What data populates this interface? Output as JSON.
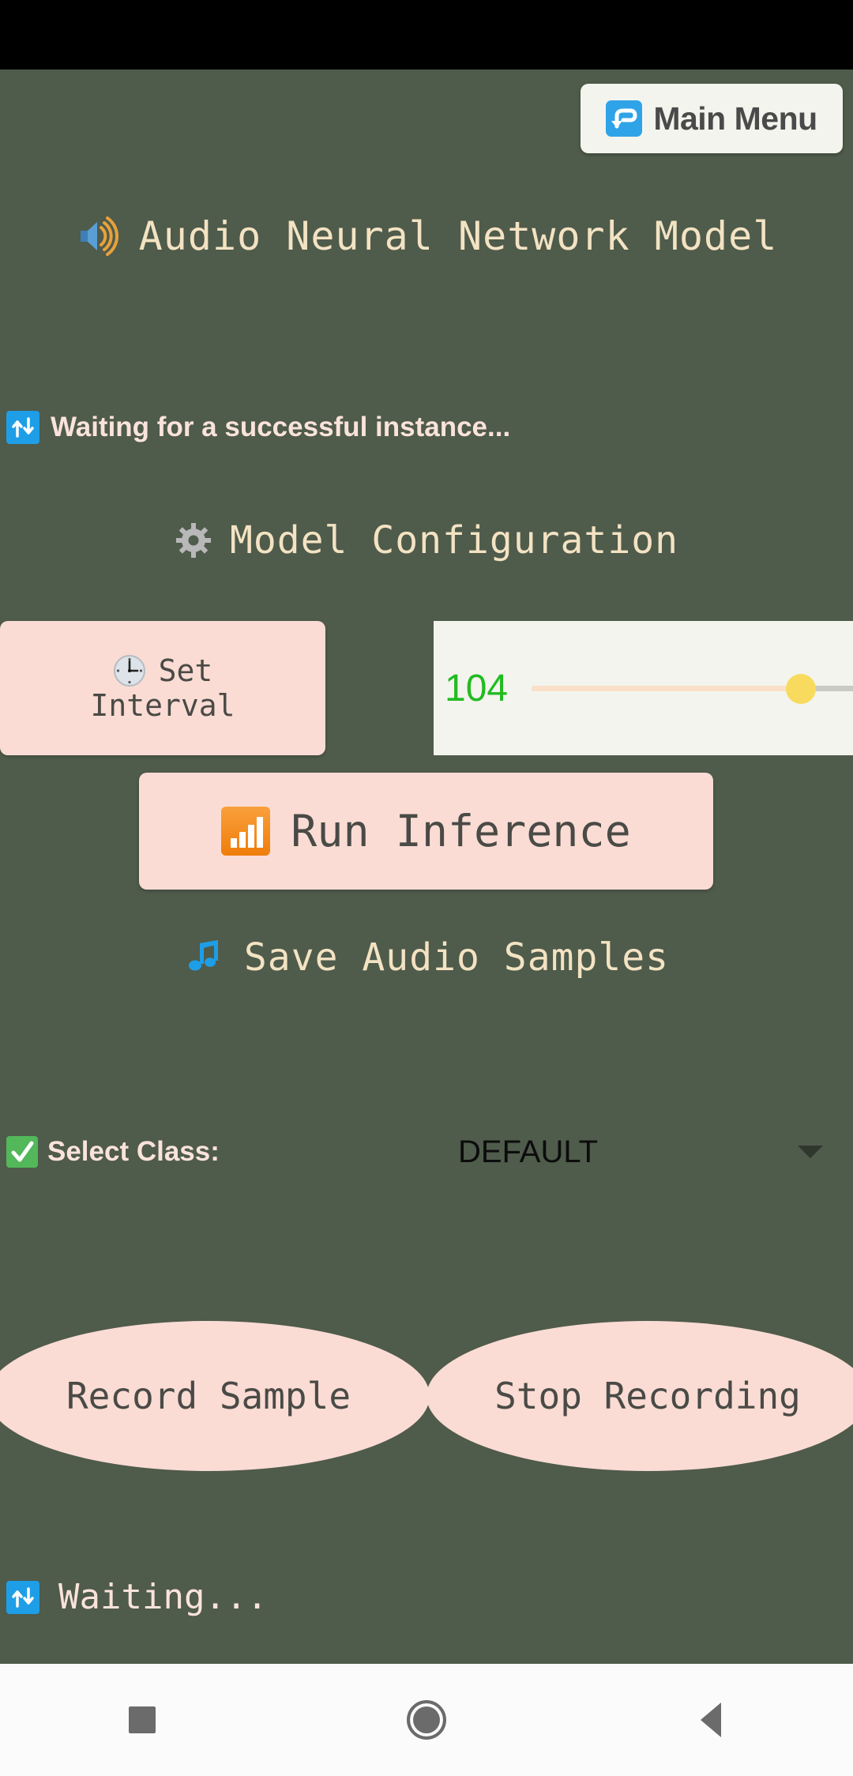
{
  "app": {
    "title": "Audio Neural Network Model",
    "title_icon": "loud-speaker-icon"
  },
  "header": {
    "main_menu_label": "Main Menu",
    "main_menu_icon": "return-arrow-icon"
  },
  "status": {
    "top_message": "Waiting for a successful instance...",
    "top_icon": "up-down-arrow-icon",
    "bottom_message": "Waiting...",
    "bottom_icon": "up-down-arrow-icon"
  },
  "config": {
    "heading": "Model Configuration",
    "heading_icon": "gear-icon",
    "set_interval_line1": "Set",
    "set_interval_line2": "Interval",
    "set_interval_icon": "clock-icon",
    "slider_value": "104",
    "slider_percent": 83,
    "run_inference_label": "Run Inference",
    "run_inference_icon": "bar-chart-icon"
  },
  "save_audio": {
    "heading": "Save Audio Samples",
    "heading_icon": "musical-notes-icon",
    "select_class_label": "Select Class:",
    "select_class_icon": "check-mark-icon",
    "selected_class": "DEFAULT",
    "record_label": "Record Sample",
    "stop_label": "Stop Recording"
  },
  "navbar": {
    "recents": "recents-square",
    "home": "home-circle",
    "back": "back-triangle"
  },
  "colors": {
    "background": "#4f5b4b",
    "panel": "#fadcd4",
    "heading_text": "#f3e3c3",
    "status_text": "#fae3da",
    "slider_value": "#22bb22",
    "slider_thumb": "#f8db5e",
    "slider_fill": "#fae0c8",
    "accent_blue": "#2fa3e8"
  }
}
